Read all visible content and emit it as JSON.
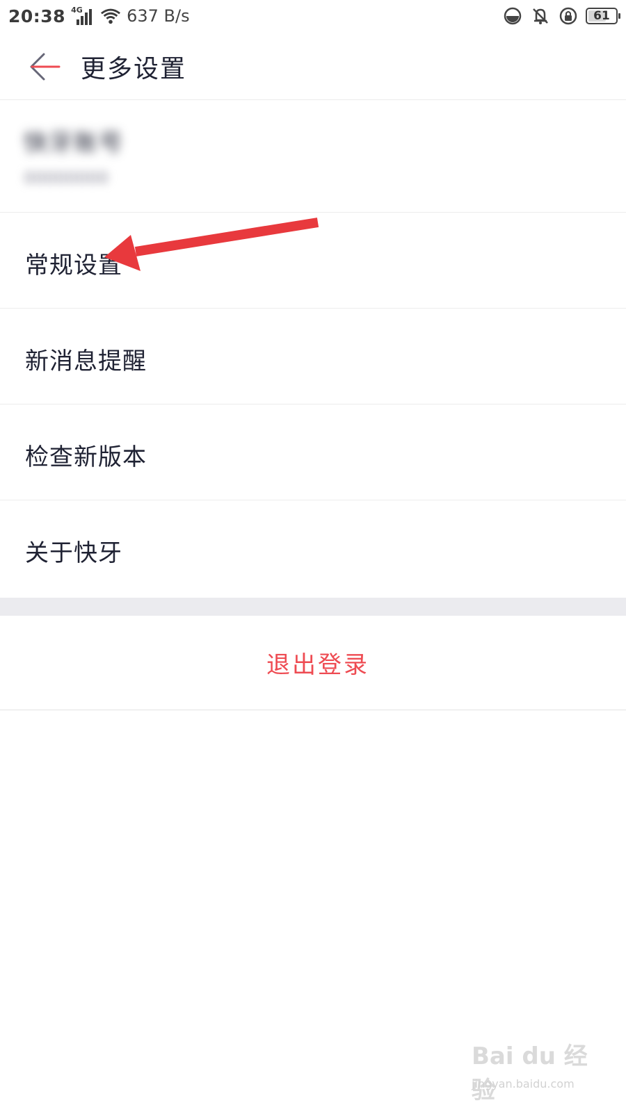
{
  "status_bar": {
    "time": "20:38",
    "network_type": "4G",
    "speed": "637 B/s",
    "battery": "61"
  },
  "header": {
    "title": "更多设置",
    "back_icon": "arrow-left-icon"
  },
  "account": {
    "name": "快牙账号",
    "id": "00000000"
  },
  "menu": [
    {
      "label": "常规设置"
    },
    {
      "label": "新消息提醒"
    },
    {
      "label": "检查新版本"
    },
    {
      "label": "关于快牙"
    }
  ],
  "logout_label": "退出登录",
  "watermark": {
    "logo": "Bai du 经验",
    "url": "jingyan.baidu.com"
  },
  "colors": {
    "text_primary": "#1f2233",
    "logout_red": "#ee4b52",
    "annotation_red": "#e8393d",
    "divider_band": "#ebebef"
  }
}
